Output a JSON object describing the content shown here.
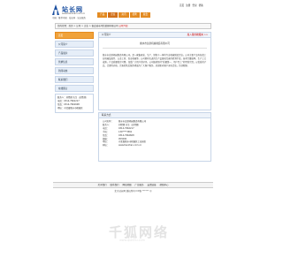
{
  "header": {
    "logo_title": "站长网",
    "logo_url": "www.tianzhan.com.cn",
    "logo_slogan": "中国 · 推荐中国 · 站长网 · 站长服务",
    "top_links": [
      "首页",
      "注册",
      "登录",
      "帮助"
    ],
    "nav": [
      "产品",
      "企业",
      "资讯",
      "招聘",
      "展会"
    ]
  },
  "breadcrumb": {
    "prefix": "您的位置：首页 > 公司 > 企业 > 省会城市河北莆田有限公司",
    "highlight": "公司介绍"
  },
  "sidebar": {
    "items": [
      "首页",
      "公司简介",
      "产品展示",
      "供求信息",
      "新闻动态",
      "联系我们",
      "在线留言"
    ],
    "contact": [
      "联系人：刘经理 先生（总经理）",
      "电话：0314-7962217",
      "传真：0314-7962608",
      "地址：河北省衡水市桃城区"
    ]
  },
  "main": {
    "header_label": "公司简介",
    "header_link": "加入我的收藏夹 >>",
    "company_name": "衡水市龙新机械制造有限公司",
    "description": "衡水市龙新机械制造有限公司，是一家集研发、生产、销售于一体的专业机械制造企业。公司主要产品有各类工业机械及配件、五金工具、农业机械等。公司拥有先进的生产设备和完善的检测手段，技术力量雄厚，生产工艺成熟，产品质量稳定可靠，深受广大用户的好评。公司始终坚持“质量第一、用户至上”的经营宗旨，以优质的产品、合理的价格、完善的售后服务竭诚为广大客户服务，欢迎新老客户来电洽谈，共创辉煌。"
  },
  "contact_section": {
    "title": "联系方式",
    "rows": [
      {
        "k": "公司名称：",
        "v": "衡水市龙新机械制造有限公司"
      },
      {
        "k": "联系人：",
        "v": "刘经理 先生（总经理）"
      },
      {
        "k": "电话：",
        "v": "0314-7962217"
      },
      {
        "k": "手机：",
        "v": "139****3651"
      },
      {
        "k": "传真：",
        "v": "0314-7962608"
      },
      {
        "k": "邮编：",
        "v": "053000"
      },
      {
        "k": "地址：",
        "v": "河北省衡水市桃城区工业园区"
      },
      {
        "k": "网址：",
        "v": "www.tianzhan.com.cn"
      }
    ]
  },
  "footer": {
    "links": [
      "关于我们",
      "联系我们",
      "网站地图",
      "广告服务",
      "友情链接",
      "帮助中心"
    ],
    "copyright": "北京站长网  版权所有  ICP备 ****** 号"
  },
  "watermark": {
    "title": "千狐网络",
    "url": "www.qianhu.com"
  }
}
